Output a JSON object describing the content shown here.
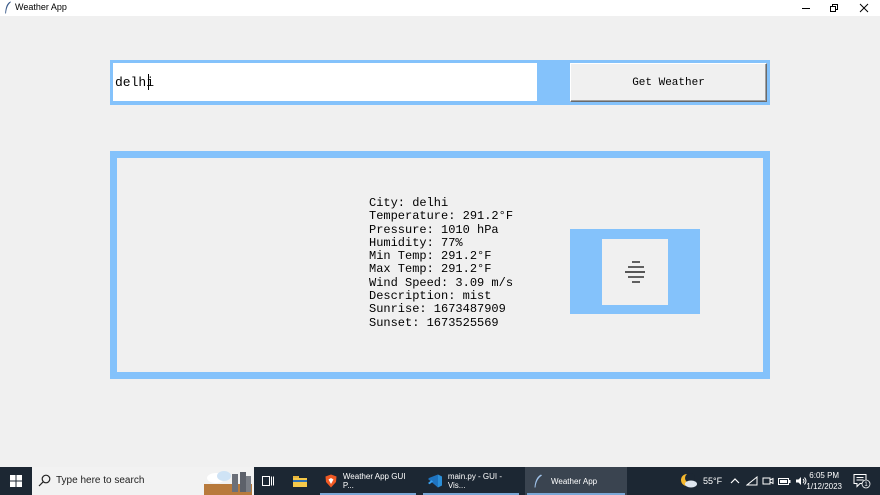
{
  "window": {
    "title": "Weather App"
  },
  "search": {
    "value": "delhi",
    "button_label": "Get Weather"
  },
  "weather": {
    "lines": [
      "City: delhi",
      "Temperature: 291.2°F",
      "Pressure: 1010 hPa",
      "Humidity: 77%",
      "Min Temp: 291.2°F",
      "Max Temp: 291.2°F",
      "Wind Speed: 3.09 m/s",
      "Description: mist",
      "Sunrise: 1673487909",
      "Sunset: 1673525569"
    ],
    "icon": "mist-icon"
  },
  "taskbar": {
    "search_placeholder": "Type here to search",
    "tasks": [
      "Weather App GUI P...",
      "main.py - GUI - Vis...",
      "Weather App"
    ],
    "weather_temp": "55°F",
    "time": "6:05 PM",
    "date": "1/12/2023",
    "notification_count": "1"
  },
  "colors": {
    "frame_accent": "#84c2fb",
    "window_bg": "#f0f0f0",
    "taskbar_bg": "#1c2733"
  }
}
